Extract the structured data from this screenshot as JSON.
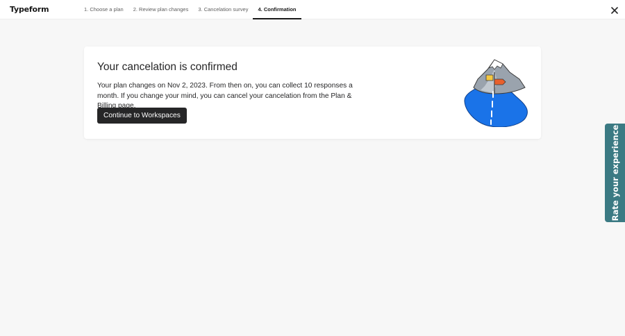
{
  "app": {
    "logo": "Typeform"
  },
  "steps": [
    {
      "label": "1. Choose a plan"
    },
    {
      "label": "2. Review plan changes"
    },
    {
      "label": "3. Cancelation survey"
    },
    {
      "label": "4. Confirmation",
      "active": true
    }
  ],
  "card": {
    "title": "Your cancelation is confirmed",
    "body": "Your plan changes on Nov 2, 2023. From then on, you can collect 10 responses a month. If you change your mind, you can cancel your cancelation from the Plan & Billing page.",
    "button_label": "Continue to Workspaces"
  },
  "feedback_tab": {
    "label": "Rate your experience"
  },
  "icons": {
    "close": "close-icon",
    "illustration": "mountain-road-illustration"
  },
  "colors": {
    "page_bg": "#f7f7f7",
    "primary_button": "#262627",
    "feedback_tab": "#3b7a83",
    "road_blue": "#1a73e8"
  }
}
